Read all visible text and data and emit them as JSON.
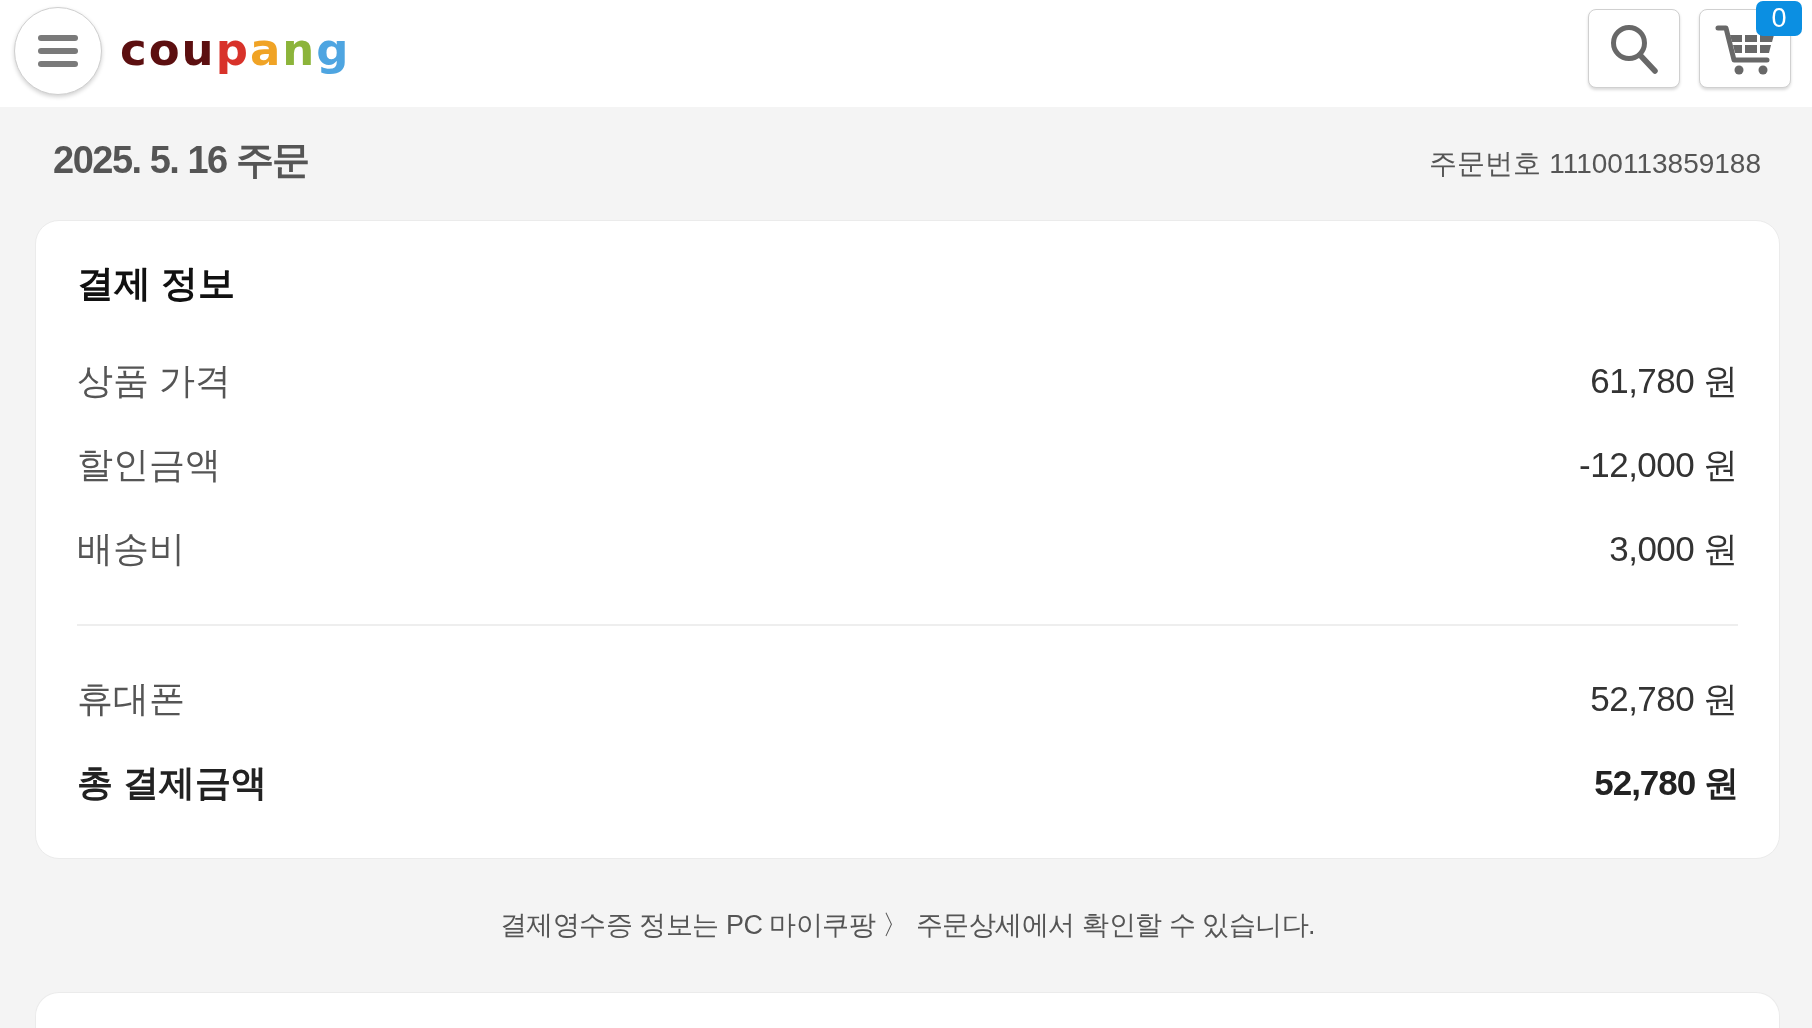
{
  "header": {
    "logo": "coupang",
    "cart_count": "0"
  },
  "order": {
    "date_title": "2025. 5. 16 주문",
    "order_number": "주문번호 11100113859188"
  },
  "payment": {
    "title": "결제 정보",
    "items": [
      {
        "label": "상품 가격",
        "value": "61,780 원"
      },
      {
        "label": "할인금액",
        "value": "-12,000 원"
      },
      {
        "label": "배송비",
        "value": "3,000 원"
      }
    ],
    "summary": [
      {
        "kind": "method",
        "label": "휴대폰",
        "value": "52,780 원"
      },
      {
        "kind": "total",
        "label": "총 결제금액",
        "value": "52,780 원"
      }
    ]
  },
  "notice": "결제영수증 정보는 PC 마이쿠팡 〉 주문상세에서 확인할 수 있습니다."
}
